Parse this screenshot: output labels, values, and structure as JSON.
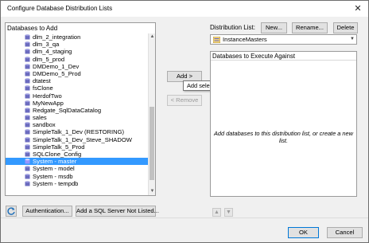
{
  "window": {
    "title": "Configure Database Distribution Lists"
  },
  "databases_panel": {
    "header": "Databases to Add",
    "items": [
      {
        "label": "dlm_2_integration",
        "selected": false
      },
      {
        "label": "dlm_3_qa",
        "selected": false
      },
      {
        "label": "dlm_4_staging",
        "selected": false
      },
      {
        "label": "dlm_5_prod",
        "selected": false
      },
      {
        "label": "DMDemo_1_Dev",
        "selected": false
      },
      {
        "label": "DMDemo_5_Prod",
        "selected": false
      },
      {
        "label": "dtatest",
        "selected": false
      },
      {
        "label": "fsClone",
        "selected": false
      },
      {
        "label": "HerdofTwo",
        "selected": false
      },
      {
        "label": "MyNewApp",
        "selected": false
      },
      {
        "label": "Redgate_SqlDataCatalog",
        "selected": false
      },
      {
        "label": "sales",
        "selected": false
      },
      {
        "label": "sandbox",
        "selected": false
      },
      {
        "label": "SimpleTalk_1_Dev (RESTORING)",
        "selected": false
      },
      {
        "label": "SimpleTalk_1_Dev_Steve_SHADOW",
        "selected": false
      },
      {
        "label": "SimpleTalk_5_Prod",
        "selected": false
      },
      {
        "label": "SQLClone_Config",
        "selected": false
      },
      {
        "label": "System - master",
        "selected": true
      },
      {
        "label": "System - model",
        "selected": false
      },
      {
        "label": "System - msdb",
        "selected": false
      },
      {
        "label": "System - tempdb",
        "selected": false
      }
    ]
  },
  "middle": {
    "add_label": "Add >",
    "remove_label": "< Remove",
    "tooltip": "Add selected databases to distribution list"
  },
  "distribution": {
    "label": "Distribution List:",
    "new_label": "New...",
    "rename_label": "Rename...",
    "delete_label": "Delete",
    "selected_list": "InstanceMasters",
    "panel_header": "Databases to Execute Against",
    "empty_hint": "Add databases to this distribution list, or create a new list."
  },
  "bottom": {
    "authentication_label": "Authentication...",
    "add_server_label": "Add a SQL Server Not Listed...",
    "ok_label": "OK",
    "cancel_label": "Cancel"
  },
  "colors": {
    "selection": "#3399ff",
    "db_icon": "#6b6bbf",
    "primary_border": "#0078d7"
  }
}
